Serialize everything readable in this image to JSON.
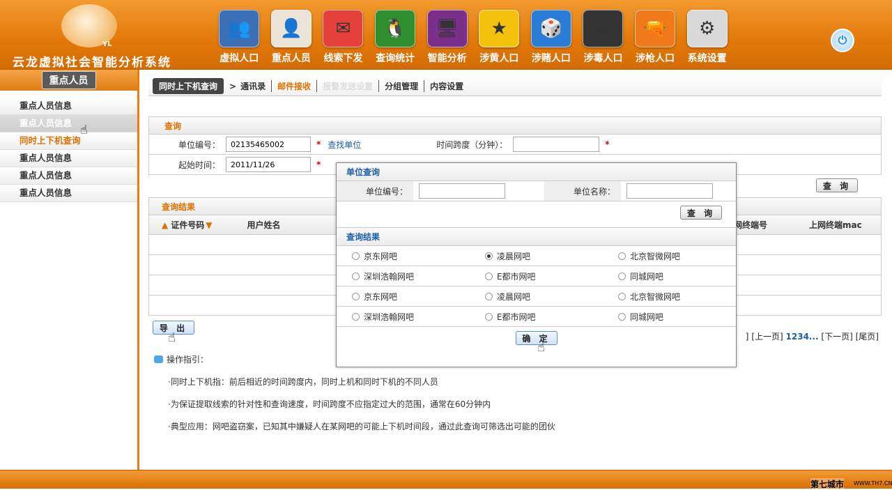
{
  "header": {
    "title": "云龙虚拟社会智能分析系统",
    "logo_text": "YL"
  },
  "nav": [
    {
      "label": "虚拟人口",
      "icon": "users-icon",
      "bg": "#3b6fb6",
      "glyph": "👥"
    },
    {
      "label": "重点人员",
      "icon": "person-pair-icon",
      "bg": "#ece4d6",
      "glyph": "👤"
    },
    {
      "label": "线索下发",
      "icon": "envelope-icon",
      "bg": "#e4413c",
      "glyph": "✉"
    },
    {
      "label": "查询统计",
      "icon": "qq-penguin-icon",
      "bg": "#2f8f2f",
      "glyph": "🐧"
    },
    {
      "label": "智能分析",
      "icon": "monitor-icon",
      "bg": "#7a2f8a",
      "glyph": "🖥"
    },
    {
      "label": "涉黄人口",
      "icon": "aim-icon",
      "bg": "#f4c20d",
      "glyph": "★"
    },
    {
      "label": "涉赌人口",
      "icon": "dice-icon",
      "bg": "#2a7dd6",
      "glyph": "🎲"
    },
    {
      "label": "涉毒人口",
      "icon": "skull-icon",
      "bg": "#333333",
      "glyph": "☠"
    },
    {
      "label": "涉枪人口",
      "icon": "gun-icon",
      "bg": "#f07a1a",
      "glyph": "🔫"
    },
    {
      "label": "系统设置",
      "icon": "gear-icon",
      "bg": "#d9d9d9",
      "glyph": "⚙"
    }
  ],
  "sidebar": {
    "title": "重点人员",
    "items": [
      "重点人员信息",
      "重点人员信息",
      "同时上下机查询",
      "重点人员信息",
      "重点人员信息",
      "重点人员信息"
    ]
  },
  "tabs": {
    "active": "同时上下机查询",
    "items": [
      "通讯录",
      "邮件接收",
      "报警发送设置",
      "分组管理",
      "内容设置"
    ]
  },
  "query": {
    "title": "查询",
    "unit_label": "单位编号：",
    "unit_value": "02135465002",
    "find_unit": "查找单位",
    "span_label": "时间跨度（分钟）：",
    "span_value": "",
    "start_label": "起始时间：",
    "start_value": "2011/11/26",
    "search_btn": "查 询"
  },
  "results": {
    "title": "查询结果",
    "columns": [
      "证件号码",
      "用户姓名",
      "网终端号",
      "上网终端mac"
    ],
    "export_btn": "导 出"
  },
  "pager": {
    "prev": "[上一页]",
    "pages": "1234...",
    "next": "[下一页]",
    "last": "[尾页]",
    "lead": "]"
  },
  "guide": {
    "title": "操作指引：",
    "items": [
      "·同时上下机指：前后相近的时间跨度内，同时上机和同时下机的不同人员",
      "·为保证提取线索的针对性和查询速度，时间跨度不应指定过大的范围，通常在60分钟内",
      "·典型应用：网吧盗窃案，已知其中嫌疑人在某网吧的可能上下机时间段，通过此查询可筛选出可能的团伙"
    ]
  },
  "modal": {
    "title": "单位查询",
    "unit_no_label": "单位编号：",
    "unit_name_label": "单位名称：",
    "search_btn": "查 询",
    "results_title": "查询结果",
    "rows": [
      [
        "京东网吧",
        "凌晨网吧",
        "北京智微网吧"
      ],
      [
        "深圳浩翰网吧",
        "E都市网吧",
        "同城网吧"
      ],
      [
        "京东网吧",
        "凌晨网吧",
        "北京智微网吧"
      ],
      [
        "深圳浩翰网吧",
        "E都市网吧",
        "同城网吧"
      ]
    ],
    "selected": "凌晨网吧",
    "ok_btn": "确 定"
  },
  "footer": {
    "watermark": "第七城市",
    "watermark_url": "WWW.TH7.CN"
  }
}
